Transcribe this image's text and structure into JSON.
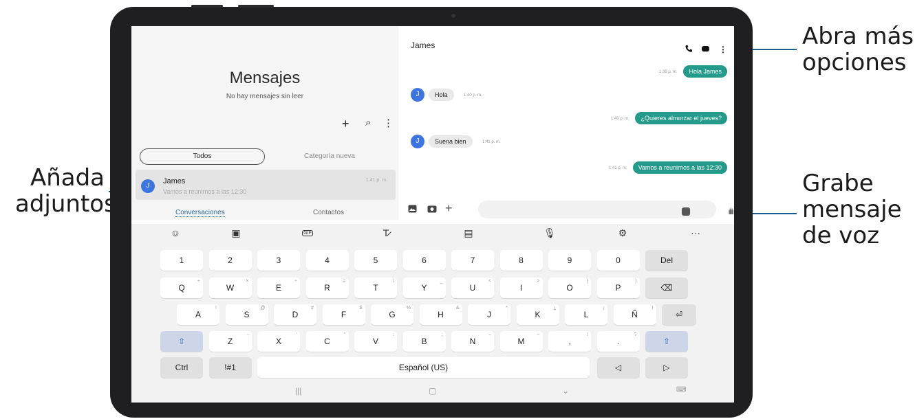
{
  "callouts": {
    "options": "Abra más\nopciones",
    "attach": "Añada\nadjuntos",
    "voice": "Grabe\nmensaje\nde voz"
  },
  "colors": {
    "accent": "#239a8a",
    "avatar": "#3e74e0",
    "callout_line": "#1c5d8c"
  },
  "left": {
    "title": "Mensajes",
    "subtitle": "No hay mensajes sin leer",
    "tools": [
      "+",
      "⌕",
      "⋮"
    ],
    "tabs": {
      "all": "Todos",
      "category": "Categoría nueva"
    },
    "conversation": {
      "avatar": "J",
      "name": "James",
      "preview": "Vamos a reunirnos a las 12:30",
      "time": "1:41 p. m."
    },
    "bottom_tabs": {
      "conversations": "Conversaciones",
      "contacts": "Contactos"
    }
  },
  "chat": {
    "name": "James",
    "header_icons": [
      "phone-icon",
      "video-icon",
      "more-icon"
    ],
    "messages": [
      {
        "dir": "out",
        "text": "Hola James",
        "time": "1:39 p. m."
      },
      {
        "dir": "in",
        "text": "Hola",
        "time": "1:40 p. m.",
        "avatar": "J"
      },
      {
        "dir": "out",
        "text": "¿Quieres almorzar el jueves?",
        "time": "1:40 p. m."
      },
      {
        "dir": "in",
        "text": "Suena bien",
        "time": "1:41 p. m.",
        "avatar": "J"
      },
      {
        "dir": "out",
        "text": "Vamos a reunirnos a las 12:30",
        "time": "1:41 p. m."
      }
    ]
  },
  "keyboard": {
    "row1": [
      "1",
      "2",
      "3",
      "4",
      "5",
      "6",
      "7",
      "8",
      "9",
      "0",
      "Del"
    ],
    "row2": [
      "Q",
      "W",
      "E",
      "R",
      "T",
      "Y",
      "U",
      "I",
      "O",
      "P"
    ],
    "row2_sub": [
      "+",
      "×",
      "÷",
      "=",
      "/",
      "_",
      "<",
      ">",
      "(",
      ")"
    ],
    "row3": [
      "A",
      "S",
      "D",
      "F",
      "G",
      "H",
      "J",
      "K",
      "L",
      "Ñ"
    ],
    "row3_sub": [
      "!",
      "@",
      "#",
      "$",
      "%",
      "&",
      "*",
      "¿",
      "¡",
      "!"
    ],
    "row4": [
      "Z",
      "X",
      "C",
      "V",
      "B",
      "N",
      "M",
      ",",
      "."
    ],
    "row4_sub": [
      "-",
      "'",
      "\"",
      ":",
      ";",
      "–",
      "~",
      "!",
      "?"
    ],
    "ctrl": "Ctrl",
    "symbols": "!#1",
    "space": "Español (US)",
    "backspace": "⌫",
    "enter": "⏎",
    "shift": "⇧",
    "left": "◁",
    "right": "▷",
    "toolbar": [
      "☺",
      "▣",
      "GIF",
      "T̷",
      "▤",
      "🎙",
      "⚙",
      "···"
    ]
  },
  "nav": {
    "recent": "|||",
    "home": "▢",
    "back": "⌄",
    "kb": "⌨"
  }
}
